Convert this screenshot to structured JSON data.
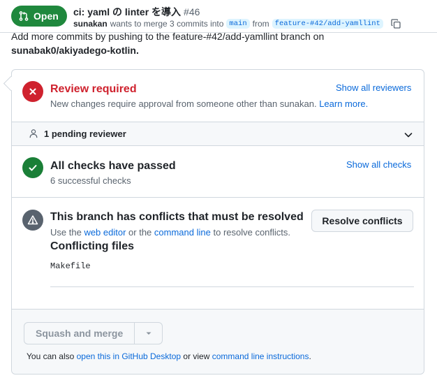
{
  "header": {
    "state_label": "Open",
    "title": "ci: yaml の linter を導入",
    "number": "#46",
    "author": "sunakan",
    "meta_text": "wants to merge 3 commits into",
    "base_branch": "main",
    "from_text": "from",
    "head_branch": "feature-#42/add-yamllint"
  },
  "behind": {
    "line1": "Add more commits by pushing to the feature-#42/add-yamllint branch on",
    "line2": "sunabak0/akiyadego-kotlin."
  },
  "review": {
    "title": "Review required",
    "description": "New changes require approval from someone other than sunakan.",
    "learn_more": "Learn more.",
    "show_all_reviewers": "Show all reviewers"
  },
  "pending": {
    "label": "1 pending reviewer"
  },
  "checks": {
    "title": "All checks have passed",
    "description": "6 successful checks",
    "show_all_checks": "Show all checks"
  },
  "conflicts": {
    "title": "This branch has conflicts that must be resolved",
    "desc_prefix": "Use the",
    "web_editor": "web editor",
    "desc_mid": "or the",
    "command_line": "command line",
    "desc_suffix": "to resolve conflicts.",
    "resolve_button": "Resolve conflicts",
    "conflicting_files_title": "Conflicting files",
    "files": [
      "Makefile"
    ]
  },
  "merge": {
    "button_label": "Squash and merge",
    "also_prefix": "You can also",
    "desktop_link": "open this in GitHub Desktop",
    "also_mid": "or view",
    "cli_link": "command line instructions",
    "also_suffix": "."
  },
  "colors": {
    "open_green": "#1f883d",
    "danger_red": "#cf222e",
    "success_green": "#1a7f37",
    "warning_gray": "#59636e",
    "link_blue": "#0969da"
  },
  "icons": [
    "git-pull-request-icon",
    "copy-icon",
    "x-icon",
    "person-icon",
    "chevron-down-icon",
    "check-icon",
    "alert-icon",
    "triangle-down-icon"
  ]
}
